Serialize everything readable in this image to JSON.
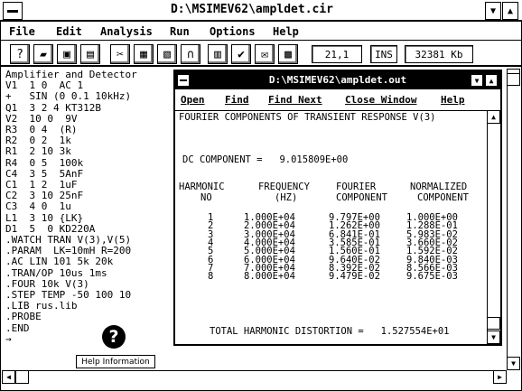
{
  "window": {
    "title": "D:\\MSIMEV62\\ampldet.cir"
  },
  "menu": [
    "File",
    "Edit",
    "Analysis",
    "Run",
    "Options",
    "Help"
  ],
  "toolbar": {
    "icons": [
      "help-icon",
      "open-icon",
      "save-icon",
      "print-icon",
      "cut-icon",
      "copy-icon",
      "paste-icon",
      "calculator-icon",
      "check-icon",
      "mail-icon",
      "spreadsheet-icon"
    ],
    "position": "21,1",
    "mode": "INS",
    "memory": "32381 Kb"
  },
  "editor": {
    "lines": [
      "Amplifier and Detector",
      "V1  1 0  AC 1",
      "+   SIN (0 0.1 10kHz)",
      "Q1  3 2 4 KT312B",
      "V2  10 0  9V",
      "R3  0 4  (R)",
      "R2  0 2  1k",
      "R1  2 10 3k",
      "R4  0 5  100k",
      "C4  3 5  5AnF",
      "C1  1 2  1uF",
      "C2  3 10 25nF",
      "C3  4 0  1u",
      "L1  3 10 {LK}",
      "D1  5  0 KD220A",
      ".WATCH TRAN V(3),V(5)",
      ".PARAM  LK=10mH R=200",
      ".AC LIN 101 5k 20k",
      ".TRAN/OP 10us 1ms",
      ".FOUR 10k V(3)",
      ".STEP TEMP -50 100 10",
      ".LIB rus.lib",
      ".PROBE",
      ".END",
      "→"
    ],
    "help_label": "Help Information"
  },
  "child": {
    "title": "D:\\MSIMEV62\\ampldet.out",
    "menu": [
      "Open",
      "Find",
      "Find Next",
      "Close Window",
      "Help"
    ],
    "heading": "FOURIER COMPONENTS OF TRANSIENT RESPONSE V(3)",
    "dc": "DC COMPONENT =   9.015809E+00",
    "cols": [
      "HARMONIC",
      "FREQUENCY",
      "FOURIER",
      "NORMALIZED"
    ],
    "cols2": [
      "NO",
      "(HZ)",
      "COMPONENT",
      "COMPONENT"
    ],
    "rows": [
      [
        "1",
        "1.000E+04",
        "9.797E+00",
        "1.000E+00"
      ],
      [
        "2",
        "2.000E+04",
        "1.262E+00",
        "1.288E-01"
      ],
      [
        "3",
        "3.000E+04",
        "6.841E-01",
        "5.983E-02"
      ],
      [
        "4",
        "4.000E+04",
        "3.585E-01",
        "3.660E-02"
      ],
      [
        "5",
        "5.000E+04",
        "1.560E-01",
        "1.592E-02"
      ],
      [
        "6",
        "6.000E+04",
        "9.640E-02",
        "9.840E-03"
      ],
      [
        "7",
        "7.000E+04",
        "8.392E-02",
        "8.566E-03"
      ],
      [
        "8",
        "8.000E+04",
        "9.479E-02",
        "9.675E-03"
      ]
    ],
    "thd": "TOTAL HARMONIC DISTORTION =   1.527554E+01"
  }
}
